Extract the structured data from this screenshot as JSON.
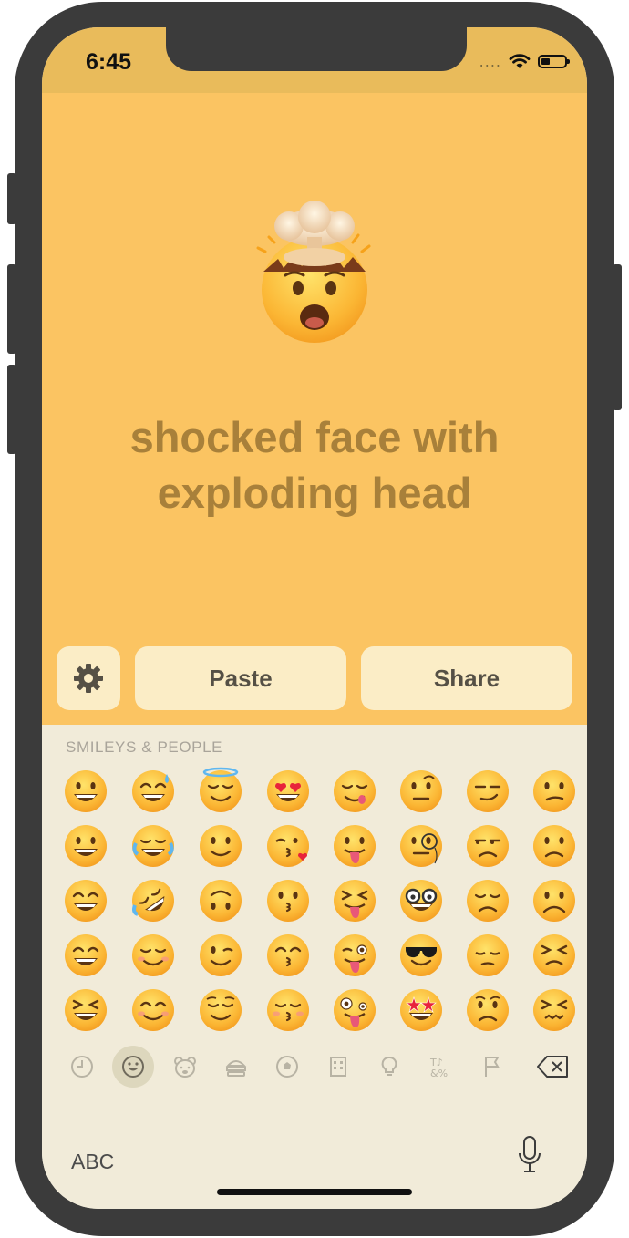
{
  "status_bar": {
    "time": "6:45",
    "signal_dots": "....",
    "wifi": "wifi-icon",
    "battery": "battery-icon"
  },
  "display": {
    "emoji_name": "shocked face with exploding head",
    "title_lines": [
      "shocked face with",
      "exploding head"
    ],
    "emoji_icon": "exploding-head-icon"
  },
  "toolbar": {
    "settings_icon": "gear-icon",
    "paste_label": "Paste",
    "share_label": "Share"
  },
  "keyboard": {
    "section_label": "SMILEYS & PEOPLE",
    "emoji_grid": [
      [
        "grinning",
        "grin-sweat",
        "halo",
        "heart-eyes",
        "yum",
        "raised-eyebrow",
        "smirk",
        "confused"
      ],
      [
        "smiley",
        "joy",
        "slight-smile",
        "kiss-heart",
        "tongue",
        "monocle",
        "unamused",
        "slight-frown"
      ],
      [
        "smile",
        "rofl",
        "upside-down",
        "kissing",
        "squint-tongue",
        "nerd",
        "disappointed",
        "frown"
      ],
      [
        "beaming",
        "relaxed",
        "wink",
        "kissing-smile",
        "wink-tongue",
        "sunglasses",
        "pensive",
        "persevere"
      ],
      [
        "laughing",
        "blush",
        "relieved",
        "kissing-closed",
        "zany",
        "star-struck",
        "worried",
        "confounded"
      ]
    ],
    "categories": [
      "clock-icon",
      "smiley-icon",
      "bear-icon",
      "burger-icon",
      "ball-icon",
      "building-icon",
      "bulb-icon",
      "symbols-icon",
      "flag-icon"
    ],
    "active_category": "smiley-icon",
    "delete_icon": "backspace-icon",
    "abc_label": "ABC",
    "mic_icon": "microphone-icon"
  },
  "colors": {
    "top_background": "#fbc462",
    "status_background": "#e9bb5b",
    "button_background": "#fbedc6",
    "keyboard_background": "#f1ebd9",
    "title_color": "#a8803a"
  }
}
